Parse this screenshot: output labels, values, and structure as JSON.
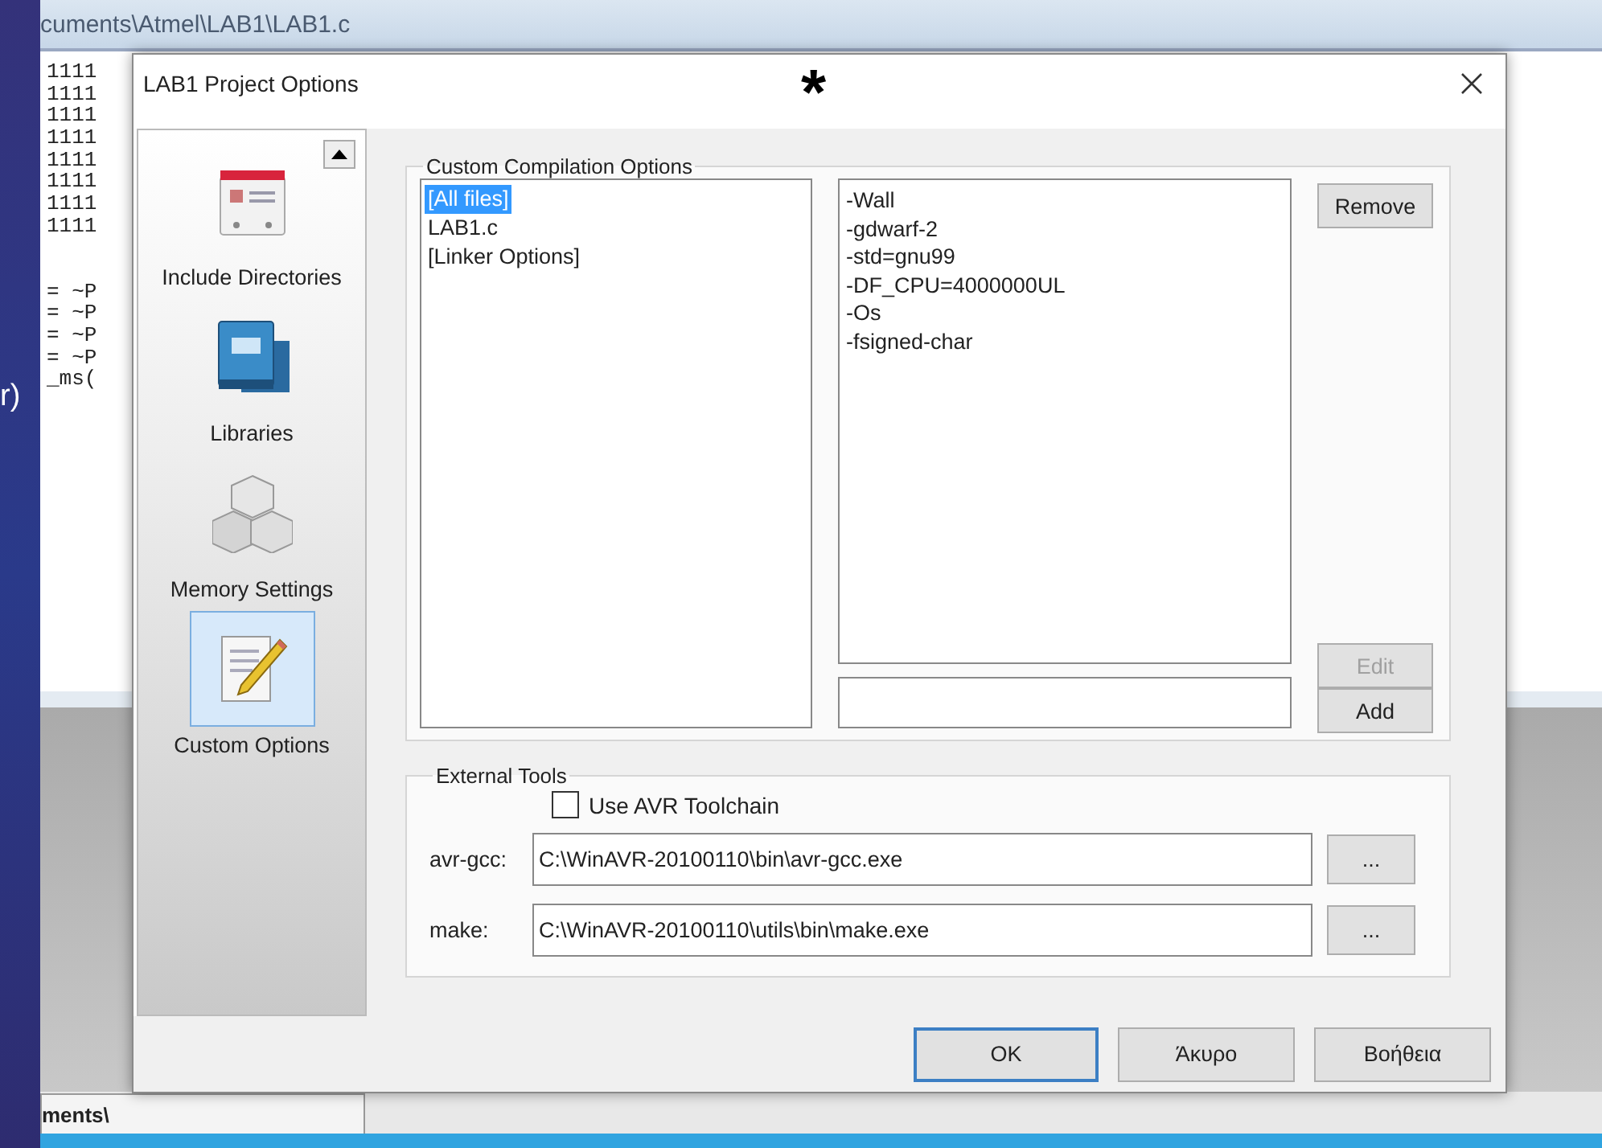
{
  "desktop_text": "r)",
  "ide": {
    "title": "cuments\\Atmel\\LAB1\\LAB1.c",
    "code_blocks": [
      [
        "1111",
        "1111",
        "1111",
        "1111",
        "1111",
        "1111",
        "1111",
        "1111"
      ],
      [
        "= ~P",
        "= ~P",
        "= ~P",
        "= ~P",
        "_ms("
      ]
    ],
    "file_tab": "ments\\"
  },
  "annotation": "*",
  "dialog": {
    "title": "LAB1 Project Options",
    "sidebar": [
      {
        "kind": "calendar",
        "label": "Include Directories",
        "selected": false
      },
      {
        "kind": "book",
        "label": "Libraries",
        "selected": false
      },
      {
        "kind": "cubes",
        "label": "Memory Settings",
        "selected": false
      },
      {
        "kind": "pencil",
        "label": "Custom Options",
        "selected": true
      }
    ],
    "compilation": {
      "title": "Custom Compilation Options",
      "files": [
        {
          "label": "[All files]",
          "selected": true
        },
        {
          "label": "LAB1.c",
          "selected": false
        },
        {
          "label": "[Linker Options]",
          "selected": false
        }
      ],
      "options": [
        "-Wall",
        "-gdwarf-2",
        "-std=gnu99",
        "-DF_CPU=4000000UL",
        "-Os",
        "-fsigned-char"
      ],
      "buttons": [
        {
          "label": "Remove",
          "disabled": false
        },
        {
          "label": "Edit",
          "disabled": true
        },
        {
          "label": "Add",
          "disabled": false
        }
      ]
    },
    "external": {
      "title": "External Tools",
      "toolchain": {
        "label": "Use AVR Toolchain",
        "checked": false
      },
      "tools": [
        {
          "label": "avr-gcc:",
          "value": "C:\\WinAVR-20100110\\bin\\avr-gcc.exe",
          "browse": "..."
        },
        {
          "label": "make:",
          "value": "C:\\WinAVR-20100110\\utils\\bin\\make.exe",
          "browse": "..."
        }
      ]
    },
    "buttons": [
      {
        "label": "OK",
        "default": true
      },
      {
        "label": "Άκυρο",
        "default": false
      },
      {
        "label": "Βοήθεια",
        "default": false
      }
    ]
  }
}
